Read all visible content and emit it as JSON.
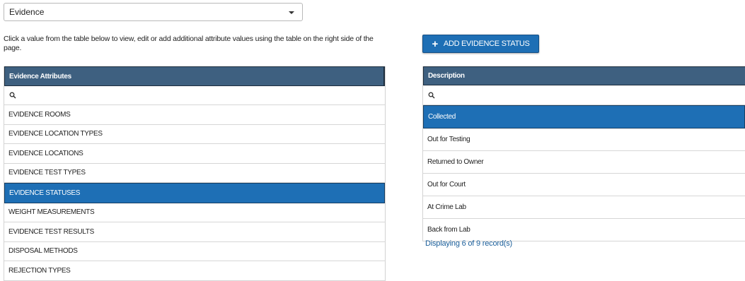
{
  "module_select": {
    "value": "Evidence"
  },
  "instructions": "Click a value from the table below to view, edit or add additional attribute values using the table on the right side of the page.",
  "add_button": {
    "label": "ADD EVIDENCE STATUS",
    "icon": "plus-icon"
  },
  "attributes_table": {
    "header": "Evidence Attributes",
    "filter_placeholder": "",
    "rows": [
      "EVIDENCE ROOMS",
      "EVIDENCE LOCATION TYPES",
      "EVIDENCE LOCATIONS",
      "EVIDENCE TEST TYPES",
      "EVIDENCE STATUSES",
      "WEIGHT MEASUREMENTS",
      "EVIDENCE TEST RESULTS",
      "DISPOSAL METHODS",
      "REJECTION TYPES"
    ],
    "selected_index": 4
  },
  "values_table": {
    "header": "Description",
    "filter_placeholder": "",
    "rows": [
      "Collected",
      "Out for Testing",
      "Returned to Owner",
      "Out for Court",
      "At Crime Lab",
      "Back from Lab"
    ],
    "selected_index": 0,
    "record_count": "Displaying 6 of 9 record(s)"
  },
  "colors": {
    "header_bg": "#3e6080",
    "selected_bg": "#1e6fb5",
    "link_text": "#1a5e9a"
  }
}
